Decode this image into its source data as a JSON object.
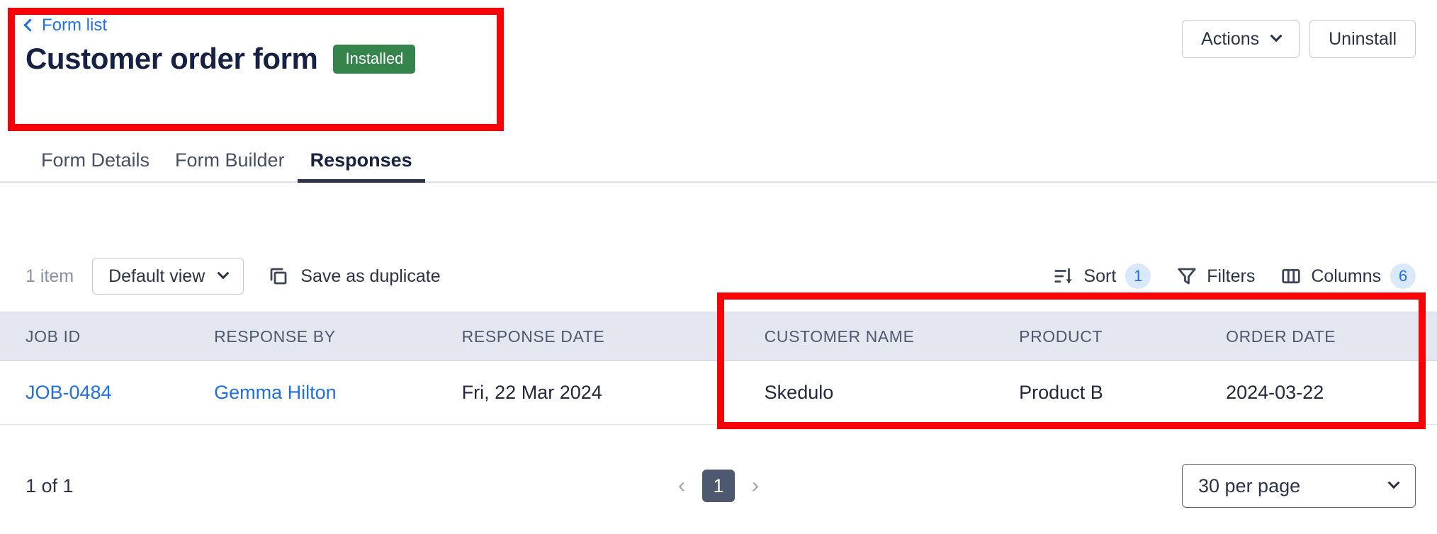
{
  "header": {
    "back_label": "Form list",
    "back_icon": "chevron-left-icon",
    "title": "Customer order form",
    "status_badge": "Installed",
    "status_badge_color": "#35844c",
    "actions_label": "Actions",
    "actions_icon": "chevron-down-icon",
    "uninstall_label": "Uninstall"
  },
  "tabs": [
    {
      "label": "Form Details",
      "active": false
    },
    {
      "label": "Form Builder",
      "active": false
    },
    {
      "label": "Responses",
      "active": true
    }
  ],
  "toolbar": {
    "item_count": "1 item",
    "view_label": "Default view",
    "view_icon": "chevron-down-icon",
    "duplicate_label": "Save as duplicate",
    "duplicate_icon": "copy-icon",
    "sort_label": "Sort",
    "sort_icon": "sort-descending-icon",
    "sort_count": "1",
    "filters_label": "Filters",
    "filters_icon": "funnel-icon",
    "columns_label": "Columns",
    "columns_icon": "columns-icon",
    "columns_count": "6",
    "pill_bg": "#d9e8fb",
    "pill_text": "#1f6fe5"
  },
  "table": {
    "columns": [
      "JOB ID",
      "RESPONSE BY",
      "RESPONSE DATE",
      "CUSTOMER NAME",
      "PRODUCT",
      "ORDER DATE"
    ],
    "rows": [
      {
        "job_id": "JOB-0484",
        "response_by": "Gemma Hilton",
        "response_date": "Fri, 22 Mar 2024",
        "customer_name": "Skedulo",
        "product": "Product B",
        "order_date": "2024-03-22"
      }
    ]
  },
  "footer": {
    "range_label": "1 of 1",
    "prev_icon": "chevron-left-icon",
    "next_icon": "chevron-right-icon",
    "current_page": "1",
    "per_page_label": "30 per page",
    "per_page_icon": "chevron-down-icon"
  },
  "annotations": {
    "color": "#fb0007",
    "boxes": [
      {
        "name": "title-highlight"
      },
      {
        "name": "custom-columns-highlight"
      }
    ]
  }
}
